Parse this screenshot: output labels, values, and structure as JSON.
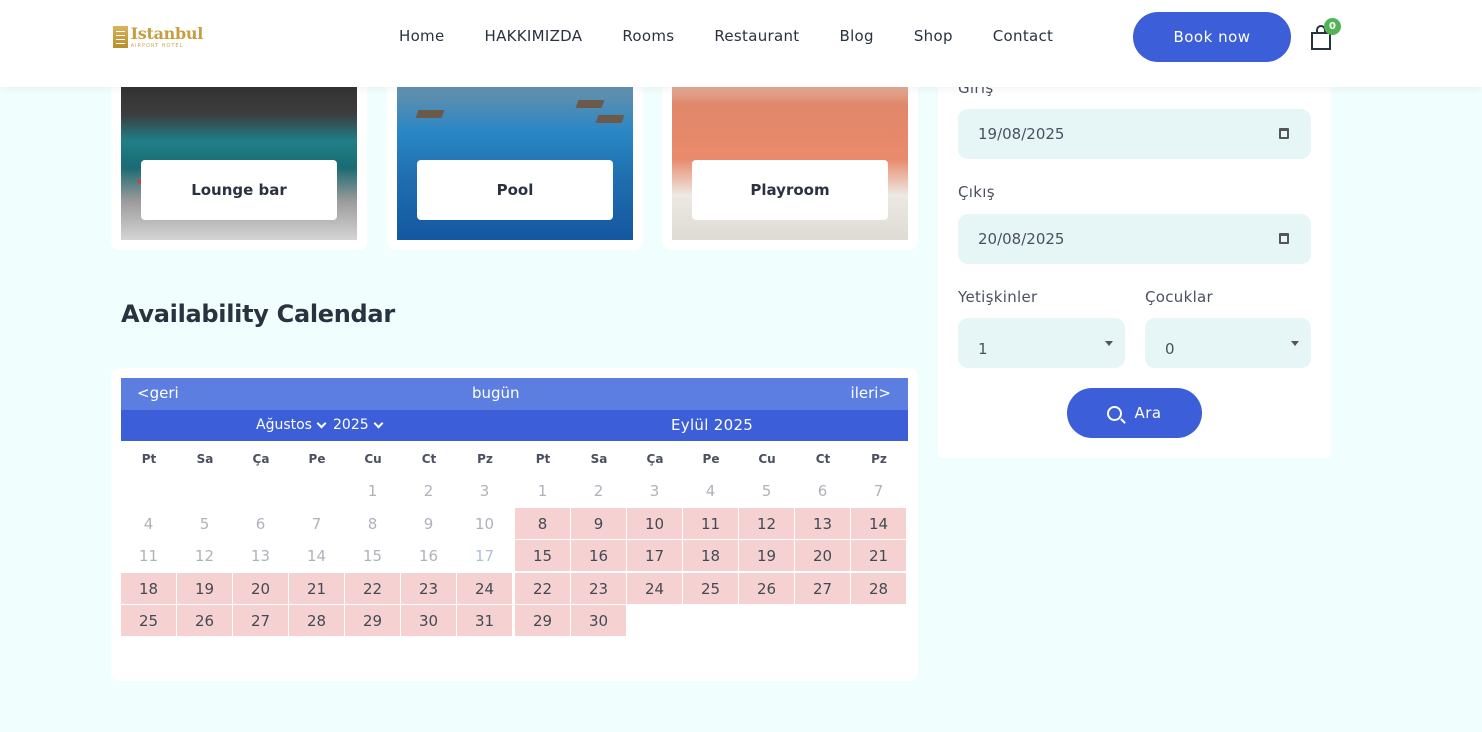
{
  "header": {
    "logo_title": "Istanbul",
    "logo_sub": "AIRPORT HOTEL",
    "nav": [
      "Home",
      "HAKKIMIZDA",
      "Rooms",
      "Restaurant",
      "Blog",
      "Shop",
      "Contact"
    ],
    "book_label": "Book now",
    "cart_count": "0"
  },
  "amenities": [
    {
      "label": "Lounge bar"
    },
    {
      "label": "Pool"
    },
    {
      "label": "Playroom"
    }
  ],
  "calendar": {
    "title": "Availability Calendar",
    "prev": "<geri",
    "today": "bugün",
    "next": "ileri>",
    "month_select": "Ağustos",
    "year_select": "2025",
    "second_month": "Eylül 2025",
    "weekdays": [
      "Pt",
      "Sa",
      "Ça",
      "Pe",
      "Cu",
      "Ct",
      "Pz"
    ],
    "august": {
      "weeks": [
        [
          "",
          "",
          "",
          "",
          "1",
          "2",
          "3"
        ],
        [
          "4",
          "5",
          "6",
          "7",
          "8",
          "9",
          "10"
        ],
        [
          "11",
          "12",
          "13",
          "14",
          "15",
          "16",
          "17"
        ],
        [
          "18",
          "19",
          "20",
          "21",
          "22",
          "23",
          "24"
        ],
        [
          "25",
          "26",
          "27",
          "28",
          "29",
          "30",
          "31"
        ]
      ]
    },
    "september": {
      "weeks": [
        [
          "1",
          "2",
          "3",
          "4",
          "5",
          "6",
          "7"
        ],
        [
          "8",
          "9",
          "10",
          "11",
          "12",
          "13",
          "14"
        ],
        [
          "15",
          "16",
          "17",
          "18",
          "19",
          "20",
          "21"
        ],
        [
          "22",
          "23",
          "24",
          "25",
          "26",
          "27",
          "28"
        ],
        [
          "29",
          "30",
          "",
          "",
          "",
          "",
          ""
        ]
      ]
    },
    "colors": {
      "booked": "#f5d1d1",
      "header_light": "#5b7ee0",
      "header_dark": "#3c5ed8"
    }
  },
  "form": {
    "checkin_label": "Giriş",
    "checkin_value": "19/08/2025",
    "checkout_label": "Çıkış",
    "checkout_value": "20/08/2025",
    "adults_label": "Yetişkinler",
    "adults_value": "1",
    "children_label": "Çocuklar",
    "children_value": "0",
    "search_label": "Ara"
  }
}
